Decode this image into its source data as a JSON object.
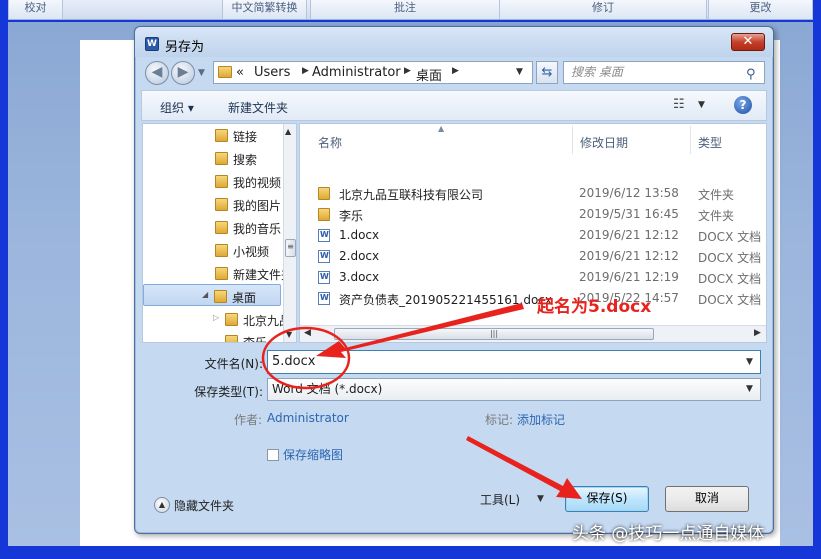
{
  "background": {
    "ribbon_labels": [
      "校对",
      "中文简繁转换",
      "批注",
      "修订",
      "更改"
    ]
  },
  "dialog": {
    "title": "另存为",
    "close_glyph": "✕"
  },
  "address_bar": {
    "prefix": "«",
    "crumbs": [
      "Users",
      "Administrator",
      "桌面"
    ],
    "search_placeholder": "搜索 桌面"
  },
  "toolbar": {
    "organize_label": "组织 ▾",
    "new_folder_label": "新建文件夹",
    "help_glyph": "?"
  },
  "nav_pane": {
    "items": [
      {
        "label": "链接",
        "indent": 1
      },
      {
        "label": "搜索",
        "indent": 1
      },
      {
        "label": "我的视频",
        "indent": 1
      },
      {
        "label": "我的图片",
        "indent": 1
      },
      {
        "label": "我的音乐",
        "indent": 1
      },
      {
        "label": "小视频",
        "indent": 1
      },
      {
        "label": "新建文件夹",
        "indent": 1
      },
      {
        "label": "桌面",
        "indent": 0,
        "selected": true
      },
      {
        "label": "北京九品互联科技有限公司",
        "indent": 2
      },
      {
        "label": "李乐",
        "indent": 2
      }
    ]
  },
  "file_list": {
    "columns": {
      "name": "名称",
      "modified": "修改日期",
      "type": "类型"
    },
    "rows": [
      {
        "name": "北京九品互联科技有限公司",
        "date": "2019/6/12 13:58",
        "type": "文件夹",
        "kind": "folder"
      },
      {
        "name": "李乐",
        "date": "2019/5/31 16:45",
        "type": "文件夹",
        "kind": "folder"
      },
      {
        "name": "1.docx",
        "date": "2019/6/21 12:12",
        "type": "DOCX 文档",
        "kind": "doc"
      },
      {
        "name": "2.docx",
        "date": "2019/6/21 12:12",
        "type": "DOCX 文档",
        "kind": "doc"
      },
      {
        "name": "3.docx",
        "date": "2019/6/21 12:19",
        "type": "DOCX 文档",
        "kind": "doc"
      },
      {
        "name": "资产负债表_201905221455161.docx",
        "date": "2019/5/22 14:57",
        "type": "DOCX 文档",
        "kind": "doc"
      }
    ]
  },
  "form": {
    "filename_label": "文件名(N):",
    "filename_value": "5.docx",
    "filetype_label": "保存类型(T):",
    "filetype_value": "Word 文档 (*.docx)",
    "author_label": "作者:",
    "author_value": "Administrator",
    "tags_label": "标记:",
    "tags_value": "添加标记",
    "thumbnail_label": "保存缩略图"
  },
  "footer": {
    "hide_folders_label": "隐藏文件夹",
    "tools_label": "工具(L)",
    "save_label": "保存(S)",
    "cancel_label": "取消"
  },
  "annotation": {
    "text": "起名为5.docx",
    "color": "#e8231e"
  },
  "watermark": "头条 @技巧一点通自媒体"
}
